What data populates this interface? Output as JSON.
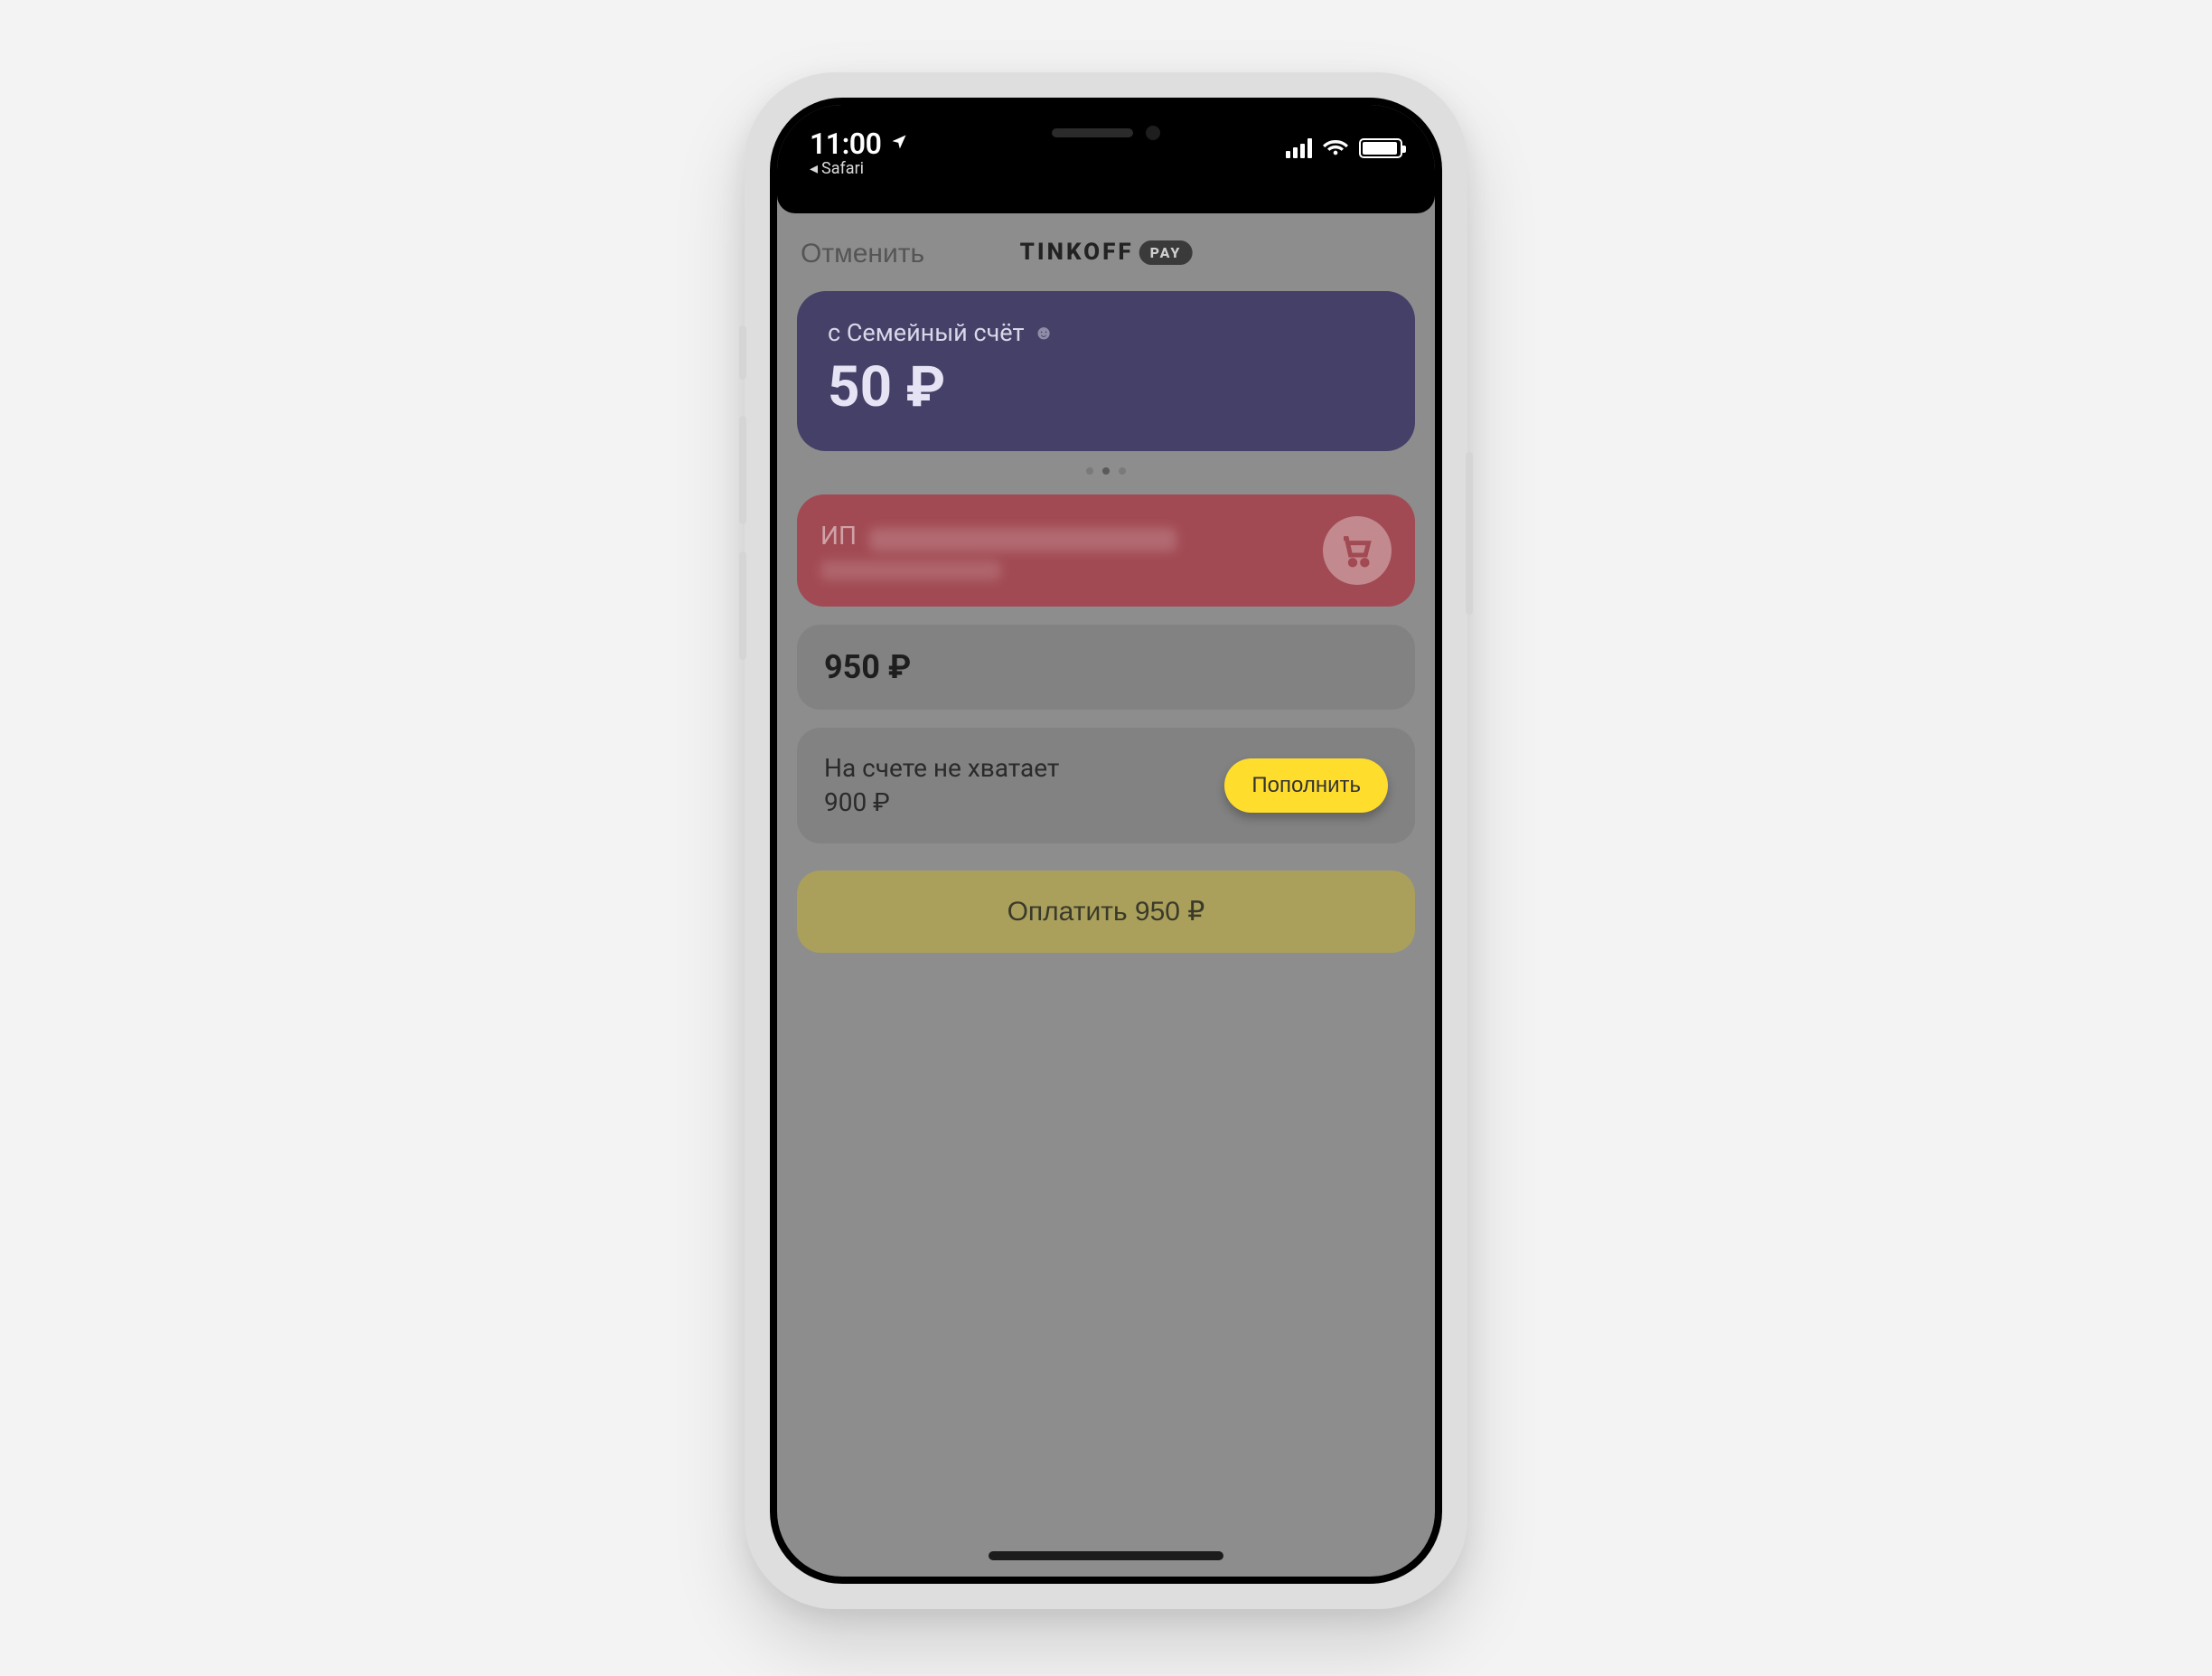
{
  "status": {
    "time": "11:00",
    "back_app": "Safari"
  },
  "header": {
    "cancel": "Отменить",
    "brand": "TINKOFF",
    "brand_badge": "PAY"
  },
  "source": {
    "label": "с Семейный счёт",
    "balance": "50 ₽"
  },
  "merchant": {
    "prefix": "ИП"
  },
  "amount": {
    "value": "950 ₽"
  },
  "warning": {
    "line1": "На счете не хватает",
    "line2": "900 ₽",
    "topup": "Пополнить"
  },
  "pay": {
    "label": "Оплатить 950 ₽"
  },
  "colors": {
    "accent_yellow": "#ffdd2d",
    "source_card": "#444067",
    "merchant_card": "#a24a53",
    "pay_disabled": "#aaa05c",
    "screen_dim": "#8d8d8d"
  }
}
